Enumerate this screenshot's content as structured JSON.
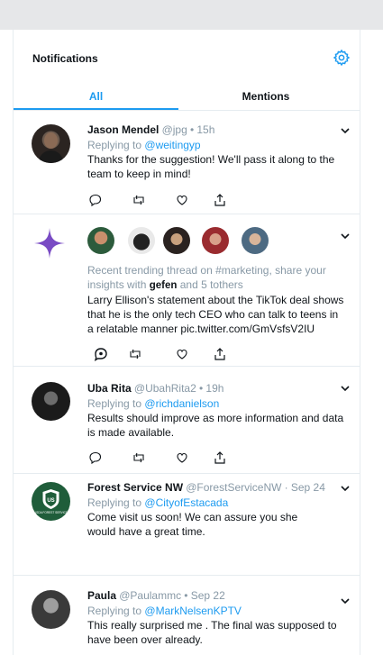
{
  "header": {
    "title": "Notifications"
  },
  "tabs": {
    "all": "All",
    "mentions": "Mentions"
  },
  "notifications": [
    {
      "name": "Jason Mendel",
      "handle": "@jpg",
      "dot": "•",
      "time": "15h",
      "replying_prefix": "Replying to",
      "replying_handle": "@weitingyp",
      "text": "Thanks for the suggestion! We'll pass it along to the team to keep in mind!"
    },
    {
      "summary": "Recent trending thread on #marketing, share your insights with",
      "summary_user": "gefen",
      "summary_rest": "and 5 tothers",
      "text": "Larry Ellison's statement about the TikTok deal shows that he is the only tech CEO who can talk to teens in a relatable manner pic.twitter.com/GmVsfsV2IU"
    },
    {
      "name": "Uba Rita",
      "handle": "@UbahRita2",
      "dot": "•",
      "time": "19h",
      "replying_prefix": "Replying to",
      "replying_handle": "@richdanielson",
      "text": "Results should improve as more information and data is made available."
    },
    {
      "name": "Forest Service NW",
      "handle": "@ForestServiceNW",
      "dot": "·",
      "time": "Sep 24",
      "replying_prefix": "Replying to",
      "replying_handle": "@CityofEstacada",
      "text": "Come visit us soon! We can assure you she would have a great time.",
      "logo_text": "USDA FOREST SERVICE"
    },
    {
      "name": "Paula",
      "handle": "@Paulammc",
      "dot": "•",
      "time": "Sep 22",
      "replying_prefix": "Replying to",
      "replying_handle": "@MarkNelsenKPTV",
      "text": "This  really surprised me . The final  was supposed  to  have been over already."
    }
  ],
  "icons": [
    "settings-gear-icon",
    "chevron-down-icon",
    "reply-icon",
    "retweet-icon",
    "like-icon",
    "share-icon",
    "sparkle-icon",
    "spaces-icon"
  ],
  "colors": {
    "accent": "#1d9bf0",
    "sparkle": "#794bc4",
    "forest_green": "#1f5d3a",
    "muted": "#8899a6"
  }
}
